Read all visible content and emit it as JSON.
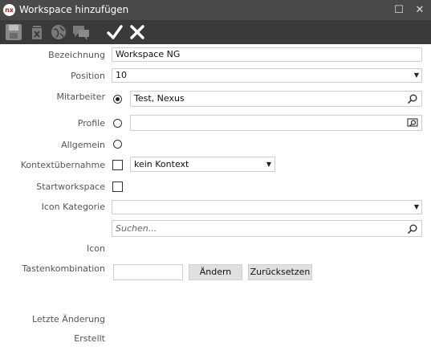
{
  "window": {
    "logo_text": "nx",
    "title": "Workspace hinzufügen",
    "maximize_glyph": "☐",
    "close_glyph": "✕"
  },
  "toolbar": {
    "icons": [
      "save-icon",
      "delete-icon",
      "globe-icon",
      "chat-icon",
      "checkmark-icon",
      "close-icon"
    ]
  },
  "form": {
    "bezeichnung": {
      "label": "Bezeichnung",
      "value": "Workspace NG"
    },
    "position": {
      "label": "Position",
      "value": "10"
    },
    "mitarbeiter": {
      "label": "Mitarbeiter",
      "value": "Test, Nexus",
      "selected": true
    },
    "profile": {
      "label": "Profile",
      "value": ""
    },
    "allgemein": {
      "label": "Allgemein"
    },
    "kontextuebernahme": {
      "label": "Kontextübernahme",
      "value": "kein Kontext"
    },
    "startworkspace": {
      "label": "Startworkspace"
    },
    "icon_kategorie": {
      "label": "Icon Kategorie",
      "value": ""
    },
    "suchen": {
      "placeholder": "Suchen..."
    },
    "icon": {
      "label": "Icon"
    },
    "tastenkombination": {
      "label": "Tastenkombination",
      "value": "",
      "aendern_label": "Ändern",
      "zuruecksetzen_label": "Zurücksetzen"
    },
    "letzte_aenderung": {
      "label": "Letzte Änderung"
    },
    "erstellt": {
      "label": "Erstellt"
    }
  }
}
